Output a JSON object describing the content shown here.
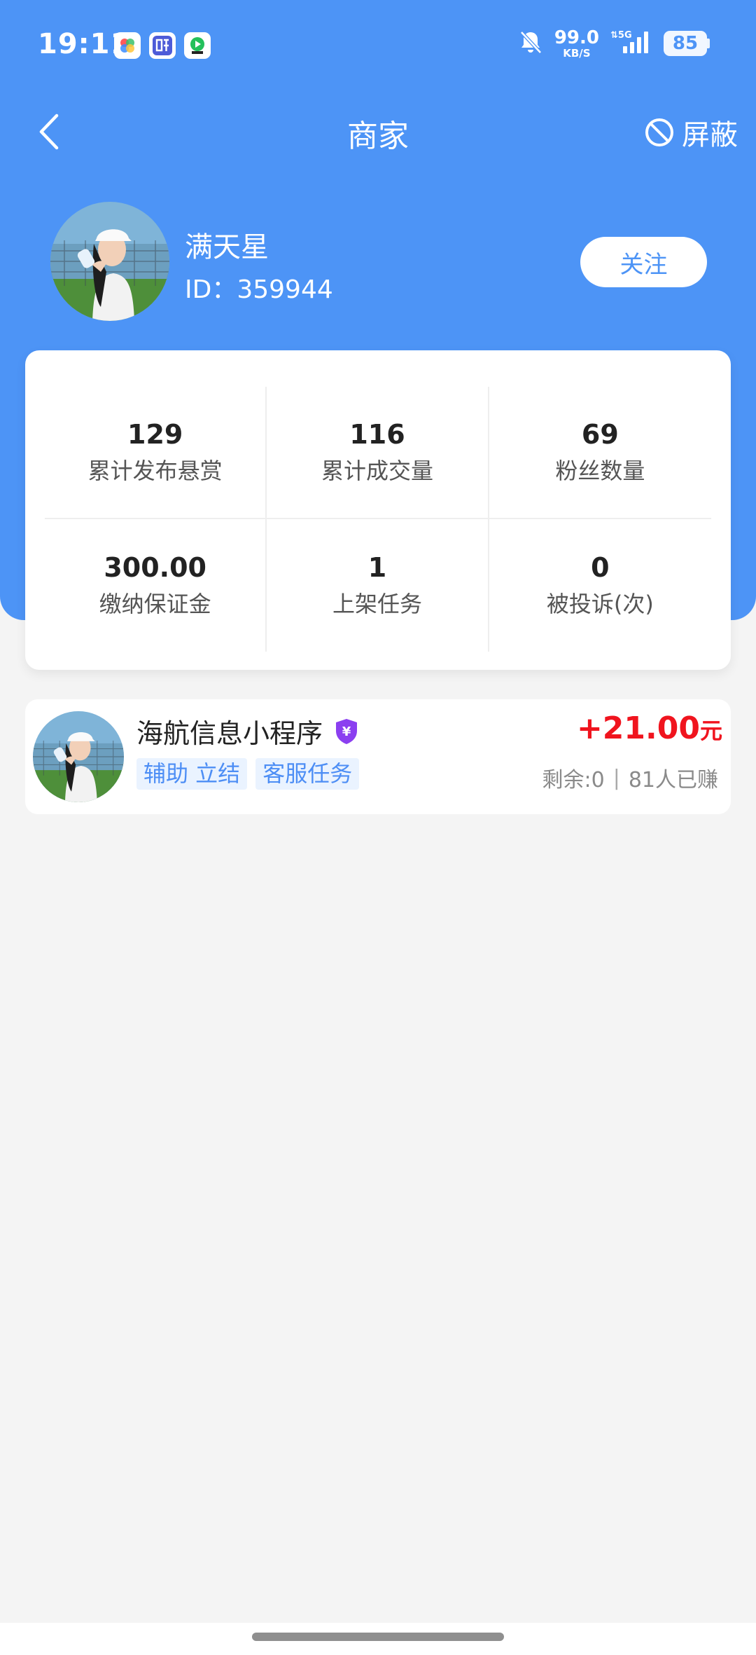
{
  "status_bar": {
    "time": "19:11",
    "app_icons": [
      "photos-app-icon",
      "tieba-app-icon",
      "video-app-icon"
    ],
    "net_speed": "99.0",
    "net_unit": "KB/S",
    "network": "5G",
    "battery": "85"
  },
  "nav": {
    "title": "商家",
    "block_label": "屏蔽"
  },
  "merchant": {
    "name": "满天星",
    "id_text": "ID：359944",
    "follow_label": "关注"
  },
  "stats": [
    {
      "value": "129",
      "label": "累计发布悬赏"
    },
    {
      "value": "116",
      "label": "累计成交量"
    },
    {
      "value": "69",
      "label": "粉丝数量"
    },
    {
      "value": "300.00",
      "label": "缴纳保证金"
    },
    {
      "value": "1",
      "label": "上架任务"
    },
    {
      "value": "0",
      "label": "被投诉(次)"
    }
  ],
  "tasks": [
    {
      "title": "海航信息小程序",
      "tags": [
        "辅助 立结",
        "客服任务"
      ],
      "reward": "+21.00",
      "reward_unit": "元",
      "remaining": "剩余:0",
      "earned": "81人已赚"
    }
  ],
  "colors": {
    "primary": "#4d94f6",
    "reward_red": "#f0141e",
    "tag_bg": "#eaf3ff",
    "verified_purple": "#8b3ff0"
  }
}
